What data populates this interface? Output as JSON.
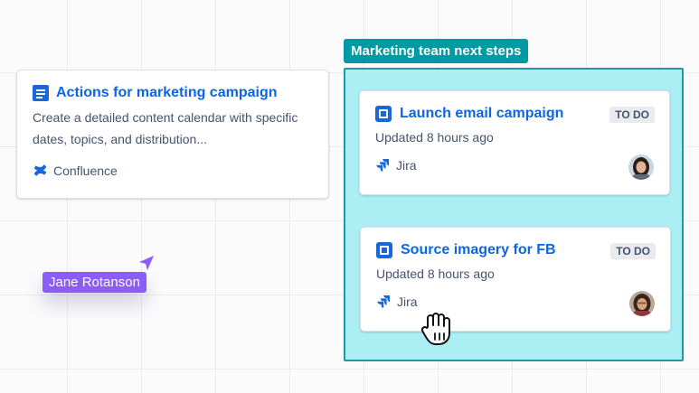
{
  "confluence_card": {
    "title": "Actions for marketing campaign",
    "description": "Create a detailed content calendar with specific dates, topics, and distribution...",
    "source": "Confluence",
    "icon": "page-icon",
    "source_icon": "confluence-icon"
  },
  "section": {
    "label": "Marketing team next steps",
    "accent_color": "#009aa2",
    "fill_color": "#abeef4"
  },
  "jira_cards": [
    {
      "title": "Launch email campaign",
      "status": "TO DO",
      "updated": "Updated 8 hours ago",
      "source": "Jira",
      "icon": "task-icon",
      "source_icon": "jira-icon",
      "avatar": "avatar-woman"
    },
    {
      "title": "Source imagery for FB",
      "status": "TO DO",
      "updated": "Updated 8 hours ago",
      "source": "Jira",
      "icon": "task-icon",
      "source_icon": "jira-icon",
      "avatar": "avatar-woman"
    }
  ],
  "collaborator_cursor": {
    "name": "Jane Rotanson",
    "color": "#8b5cf6"
  },
  "pointer": "hand-grab-cursor",
  "colors": {
    "link_blue": "#0c66e4",
    "brand_blue": "#1868db",
    "text_subtle": "#44546f"
  }
}
